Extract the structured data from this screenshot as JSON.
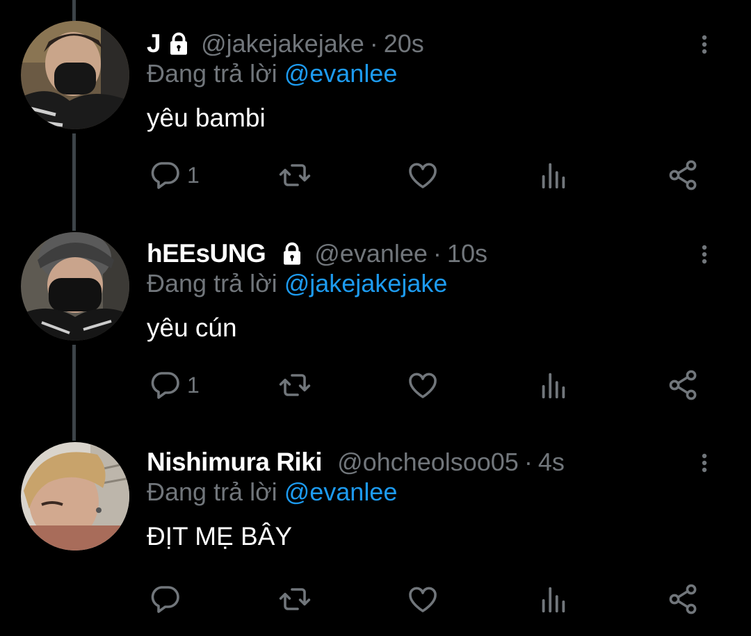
{
  "colors": {
    "background": "#000000",
    "text_primary": "#ffffff",
    "text_secondary": "#71767b",
    "link": "#1d9bf0",
    "thread_line": "#3d4449"
  },
  "tweets": [
    {
      "display_name": "J",
      "protected_icon": "lock-icon",
      "handle": "@jakejakejake",
      "separator": "·",
      "time": "20s",
      "reply_prefix": "Đang trả lời",
      "reply_to": "@evanlee",
      "text": "yêu bambi",
      "reply_count": "1"
    },
    {
      "display_name": "hEEsUNG",
      "protected_icon": "lock-icon",
      "handle": "@evanlee",
      "separator": "·",
      "time": "10s",
      "reply_prefix": "Đang trả lời",
      "reply_to": "@jakejakejake",
      "text": "yêu cún",
      "reply_count": "1"
    },
    {
      "display_name": "Nishimura Riki",
      "handle": "@ohcheolsoo05",
      "separator": "·",
      "time": "4s",
      "reply_prefix": "Đang trả lời",
      "reply_to": "@evanlee",
      "text": "ĐỊT MẸ BÂY",
      "reply_count": ""
    }
  ],
  "action_icons": [
    "reply-icon",
    "retweet-icon",
    "like-icon",
    "views-icon",
    "share-icon"
  ]
}
